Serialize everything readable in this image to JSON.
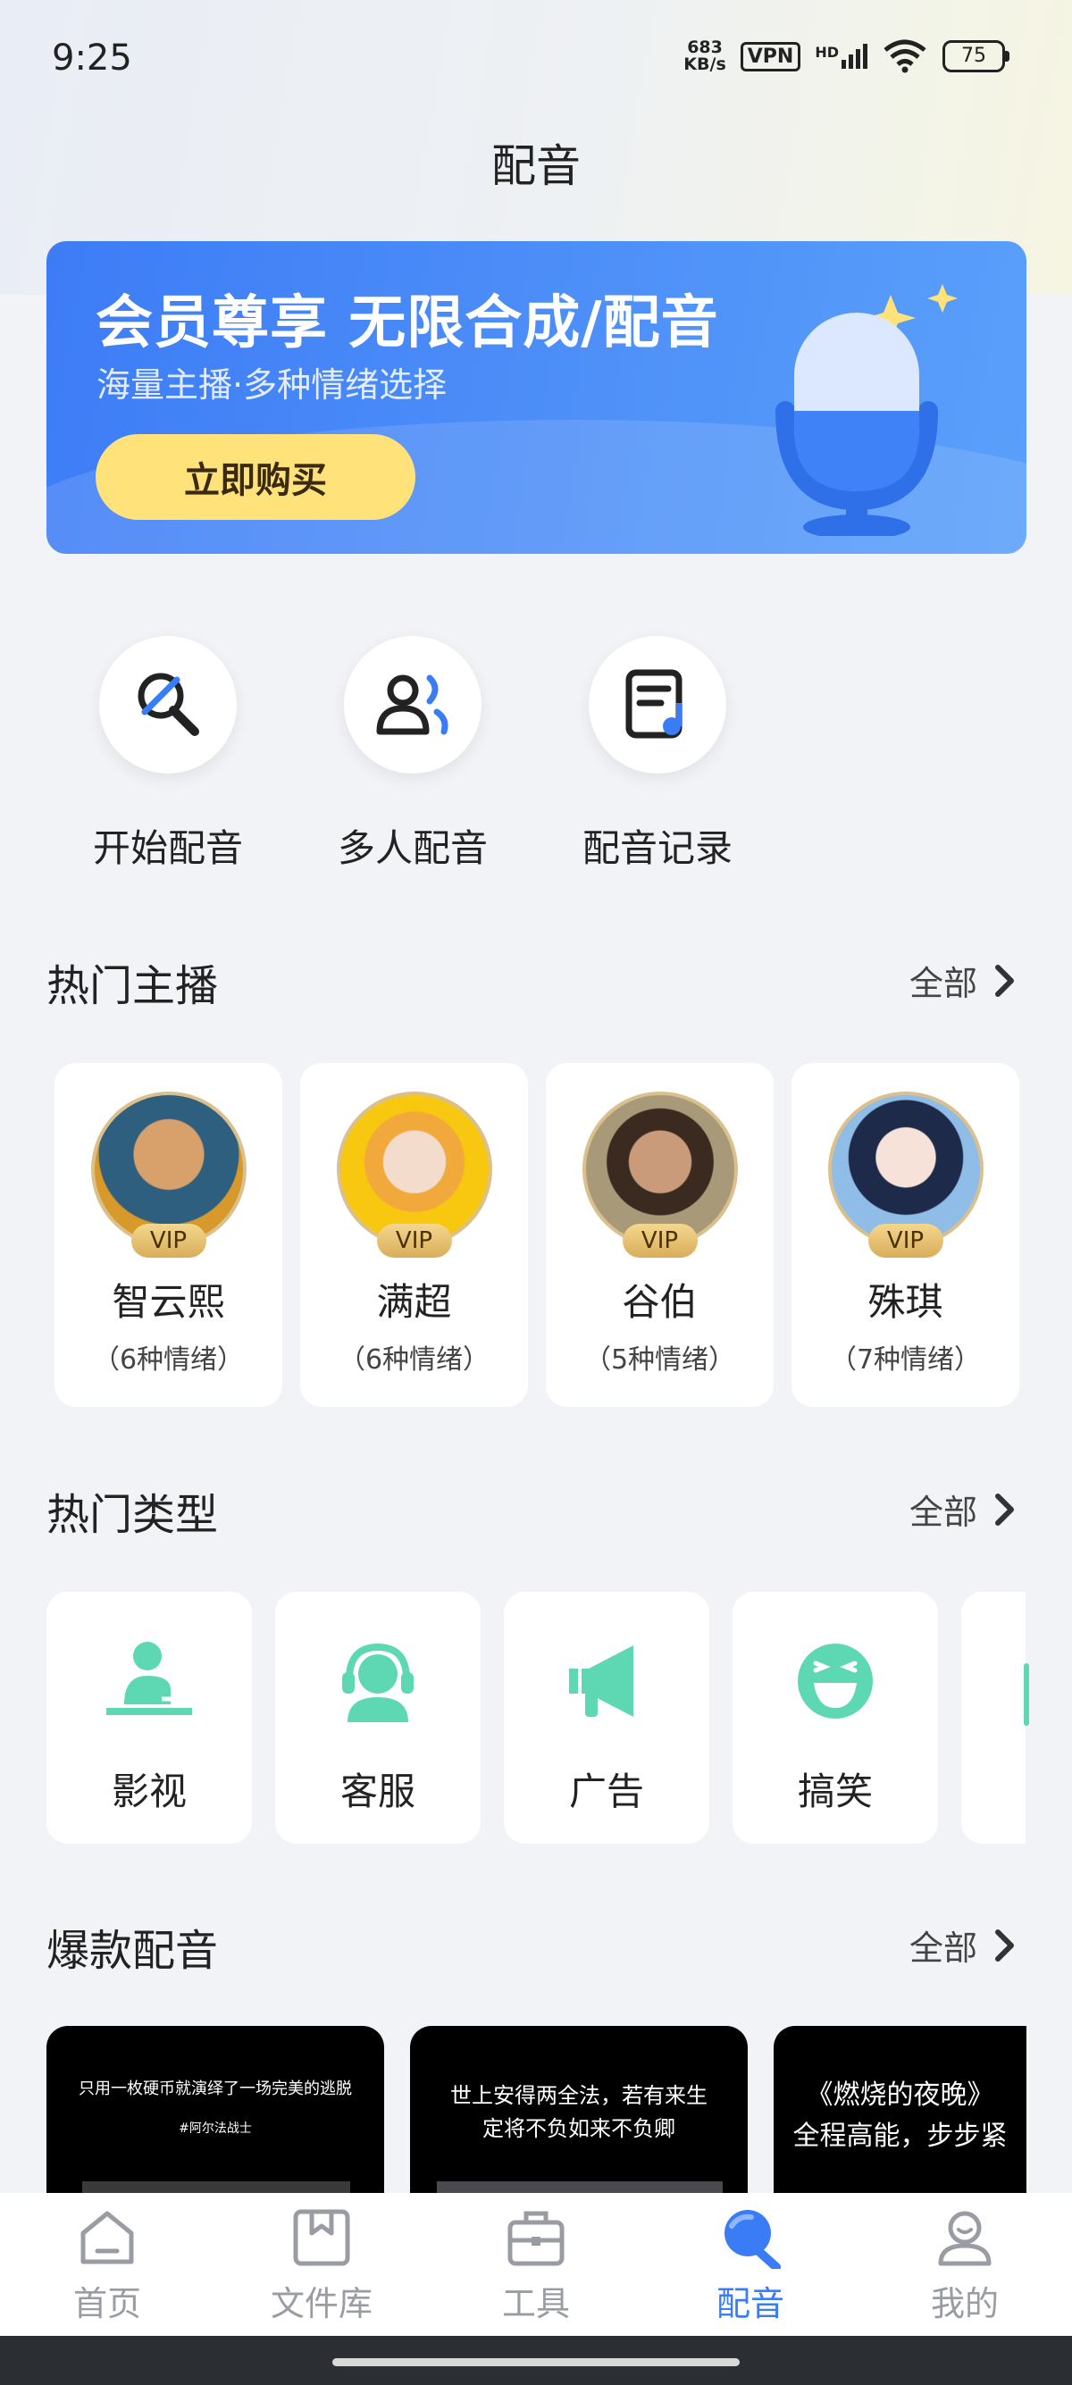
{
  "status": {
    "time": "9:25",
    "speed_top": "683",
    "speed_bottom": "KB/s",
    "vpn": "VPN",
    "hd": "HD",
    "battery": "75"
  },
  "page": {
    "title": "配音"
  },
  "banner": {
    "title": "会员尊享 无限合成/配音",
    "subtitle": "海量主播·多种情绪选择",
    "button": "立即购买"
  },
  "quick_actions": [
    {
      "label": "开始配音",
      "icon": "microphone-icon"
    },
    {
      "label": "多人配音",
      "icon": "multi-user-icon"
    },
    {
      "label": "配音记录",
      "icon": "record-list-icon"
    }
  ],
  "anchors_section": {
    "title": "热门主播",
    "more": "全部"
  },
  "anchors": [
    {
      "name": "智云熙",
      "emotions": "（6种情绪）",
      "badge": "VIP",
      "color": "#3e6d8a"
    },
    {
      "name": "满超",
      "emotions": "（6种情绪）",
      "badge": "VIP",
      "color": "#f4c20d"
    },
    {
      "name": "谷伯",
      "emotions": "（5种情绪）",
      "badge": "VIP",
      "color": "#8b7a5a"
    },
    {
      "name": "殊琪",
      "emotions": "（7种情绪）",
      "badge": "VIP",
      "color": "#6f9fd8"
    }
  ],
  "types_section": {
    "title": "热门类型",
    "more": "全部"
  },
  "types": [
    {
      "label": "影视",
      "icon": "film-presenter-icon"
    },
    {
      "label": "客服",
      "icon": "headset-icon"
    },
    {
      "label": "广告",
      "icon": "megaphone-icon"
    },
    {
      "label": "搞笑",
      "icon": "laugh-face-icon"
    }
  ],
  "hot_section": {
    "title": "爆款配音",
    "more": "全部"
  },
  "hot_items": [
    {
      "line1": "只用一枚硬币就演绎了一场完美的逃脱",
      "line2": "#阿尔法战士"
    },
    {
      "line1": "世上安得两全法，若有来生",
      "line2": "定将不负如来不负卿"
    },
    {
      "line1": "《燃烧的夜晚》",
      "line2": "全程高能，步步紧"
    }
  ],
  "nav": [
    {
      "label": "首页",
      "icon": "home-icon",
      "active": false
    },
    {
      "label": "文件库",
      "icon": "file-library-icon",
      "active": false
    },
    {
      "label": "工具",
      "icon": "toolbox-icon",
      "active": false
    },
    {
      "label": "配音",
      "icon": "dubbing-icon",
      "active": true
    },
    {
      "label": "我的",
      "icon": "profile-icon",
      "active": false
    }
  ],
  "colors": {
    "accent": "#3a7cf6",
    "teal": "#5dd8b2",
    "vip_gold": "#d9ad5b"
  }
}
